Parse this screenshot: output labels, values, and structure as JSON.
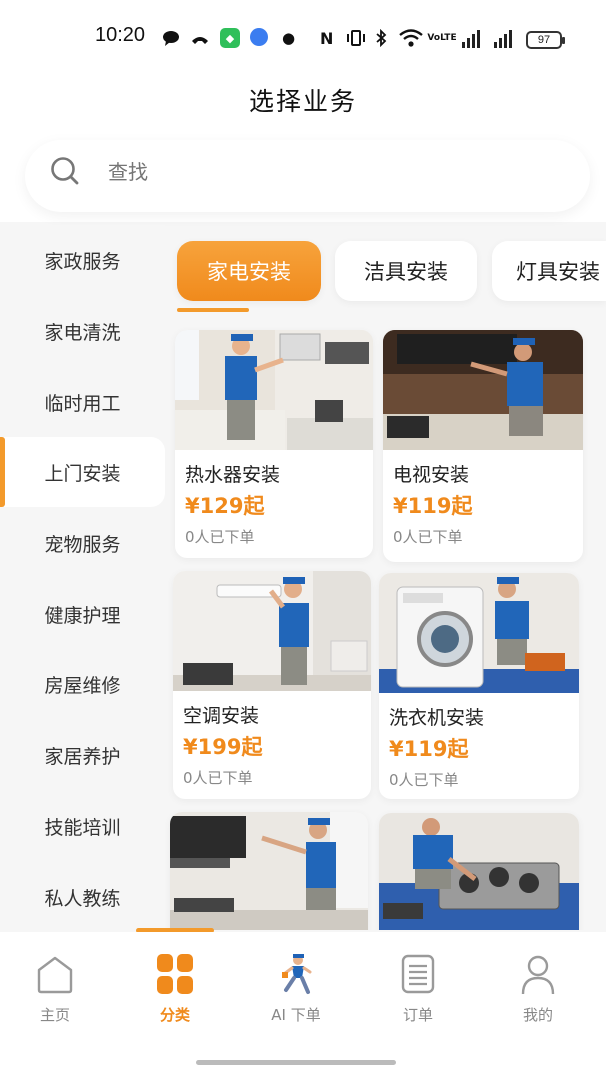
{
  "status_bar": {
    "time": "10:20",
    "nfc_label": "N",
    "network_label": "VoLTE",
    "battery": "97"
  },
  "header": {
    "title": "选择业务"
  },
  "search": {
    "placeholder": "查找"
  },
  "sidebar": {
    "items": [
      {
        "label": "家政服务"
      },
      {
        "label": "家电清洗"
      },
      {
        "label": "临时用工"
      },
      {
        "label": "上门安装"
      },
      {
        "label": "宠物服务"
      },
      {
        "label": "健康护理"
      },
      {
        "label": "房屋维修"
      },
      {
        "label": "家居养护"
      },
      {
        "label": "技能培训"
      },
      {
        "label": "私人教练"
      }
    ],
    "active_index": 3
  },
  "tabs": [
    {
      "label": "家电安装"
    },
    {
      "label": "洁具安装"
    },
    {
      "label": "灯具安装"
    }
  ],
  "products": [
    {
      "title": "热水器安装",
      "price": "¥129起",
      "sold": "0人已下单"
    },
    {
      "title": "电视安装",
      "price": "¥119起",
      "sold": "0人已下单"
    },
    {
      "title": "空调安装",
      "price": "¥199起",
      "sold": "0人已下单"
    },
    {
      "title": "洗衣机安装",
      "price": "¥119起",
      "sold": "0人已下单"
    },
    {
      "title": "",
      "price": "",
      "sold": ""
    },
    {
      "title": "",
      "price": "",
      "sold": ""
    }
  ],
  "bottom_nav": [
    {
      "label": "主页",
      "icon": "home-icon"
    },
    {
      "label": "分类",
      "icon": "category-grid-icon"
    },
    {
      "label": "AI 下单",
      "icon": "running-worker-icon"
    },
    {
      "label": "订单",
      "icon": "order-list-icon"
    },
    {
      "label": "我的",
      "icon": "profile-icon"
    }
  ],
  "colors": {
    "accent": "#f08a1c",
    "background": "#f6f6f6"
  }
}
